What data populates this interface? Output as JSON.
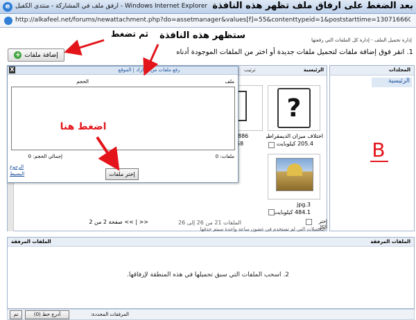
{
  "window": {
    "title": "أرفق ملف في المشاركة - منتدى الكفيل - Windows Internet Explorer",
    "overlay_caption": "بعد الضغط على ارفاق ملف تظهر هذه النافذة",
    "url": "http://alkafeel.net/forums/newattachment.php?do=assetmanager&values[f]=55&contenttypeid=1&poststarttime=1307166602&"
  },
  "header": {
    "breadcrumb": "إدارة تحميل الملف - إدارة كل الملفات التي رفعتها",
    "instruction": "1. انقر فوق إضافة ملفات لتحميل ملفات جديدة أو اختر من الملفات الموجودة أدناه",
    "add_files_label": "إضافة ملفات"
  },
  "annotations": {
    "window_appears": "ستظهر هذه النافذة",
    "then_click": "ثم تضغط",
    "click_here": "اضغط هنا",
    "b_label": "B"
  },
  "folders": {
    "title": "المجلدات",
    "home": "الرئيسية"
  },
  "browser": {
    "title": "الرئيسية",
    "sort_label": "ترتيب",
    "files": [
      {
        "name": "اختلاف ميزان الديمقراطية.df",
        "size": "205.4 كيلوبايت"
      },
      {
        "name": "jpg.3",
        "size": "484.1 كيلوبايت"
      }
    ],
    "partial_size": "886",
    "partial_name": "58",
    "select_all": "إختر الكل",
    "file_range": "الملفات 21 من 26 إلى 26",
    "pagination": "<< | >> صفحة 2 من 2",
    "notice": "التحميلات التي لم تستخدم في غضون ساعة واحدة سيتم حذفها"
  },
  "popup": {
    "close_label": "X",
    "title": "رفع ملفات من جهازك | الموقع",
    "col_file": "ملف",
    "col_size": "الحجم",
    "files_count": "ملفات: 0",
    "total_size": "إجمالي الحجم: 0",
    "back_link": "الرجوع",
    "simple_link": "البسيط",
    "choose_button": "إختر ملفات"
  },
  "attachments": {
    "title_right": "الملفات المرفقة",
    "title_left": "الملفات المرفقة",
    "drag_text": "2. اسحب الملفات التي سبق تحميلها في هذه المنطقة لإرفاقها.",
    "selected_label": "المرفقات المحددة:",
    "insert_inline": "أدرج خط (0)",
    "done": "تم"
  },
  "colors": {
    "annotation_red": "#e3141a",
    "panel_border": "#9fb3cc",
    "header_bg": "#e8eef6"
  }
}
